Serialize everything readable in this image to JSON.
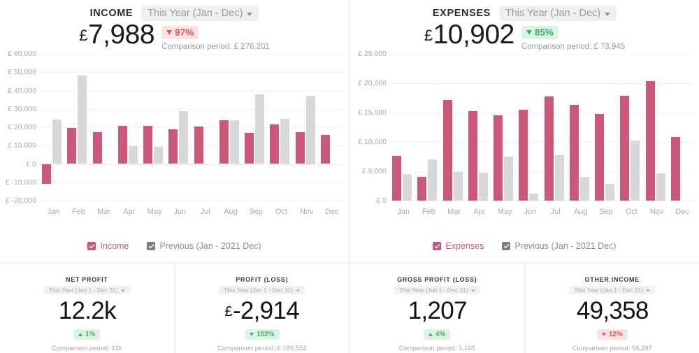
{
  "panels": [
    {
      "title": "INCOME",
      "period": "This Year (Jan - Dec)",
      "currency": "£",
      "value": "7,988",
      "delta": "97%",
      "delta_direction": "down",
      "delta_tone": "bad",
      "comparison": "Comparison period: £ 276,201",
      "legend": {
        "primary": "Income",
        "previous": "Previous (Jan - 2021 Dec)"
      },
      "accent": "#cb5878",
      "prev_color": "#d8d8d8",
      "chart_data": {
        "type": "bar",
        "title": "Income",
        "xlabel": "",
        "ylabel": "",
        "ylim": [
          -20000,
          60000
        ],
        "ytick_labels": [
          "£ 60,000",
          "£ 50,000",
          "£ 40,000",
          "£ 30,000",
          "£ 20,000",
          "£ 10,000",
          "£ 0",
          "£ -10,000",
          "£ -20,000"
        ],
        "yticks": [
          60000,
          50000,
          40000,
          30000,
          20000,
          10000,
          0,
          -10000,
          -20000
        ],
        "grid": true,
        "legend_position": "bottom",
        "categories": [
          "Jan",
          "Feb",
          "Mar",
          "Apr",
          "May",
          "Jun",
          "Jul",
          "Aug",
          "Sep",
          "Oct",
          "Nov",
          "Dec"
        ],
        "series": [
          {
            "name": "Income",
            "color": "#cb5878",
            "values": [
              -11000,
              19800,
              17200,
              20700,
              20900,
              18900,
              20400,
              23800,
              16800,
              21400,
              17200,
              15800
            ]
          },
          {
            "name": "Previous (Jan - 2021 Dec)",
            "color": "#d8d8d8",
            "values": [
              24200,
              48300,
              null,
              9900,
              9400,
              28600,
              null,
              23800,
              37900,
              24400,
              37000,
              null
            ]
          }
        ]
      }
    },
    {
      "title": "EXPENSES",
      "period": "This Year (Jan - Dec)",
      "currency": "£",
      "value": "10,902",
      "delta": "85%",
      "delta_direction": "down",
      "delta_tone": "good",
      "comparison": "Comparison period: £ 73,945",
      "legend": {
        "primary": "Expenses",
        "previous": "Previous (Jan - 2021 Dec)"
      },
      "accent": "#cb5878",
      "prev_color": "#d8d8d8",
      "chart_data": {
        "type": "bar",
        "title": "Expenses",
        "xlabel": "",
        "ylabel": "",
        "ylim": [
          0,
          25000
        ],
        "ytick_labels": [
          "£ 25,000",
          "£ 20,000",
          "£ 15,000",
          "£ 10,000",
          "£ 5,000",
          "£ 0"
        ],
        "yticks": [
          25000,
          20000,
          15000,
          10000,
          5000,
          0
        ],
        "grid": true,
        "legend_position": "bottom",
        "categories": [
          "Jan",
          "Feb",
          "Mar",
          "Apr",
          "May",
          "Jun",
          "Jul",
          "Aug",
          "Sep",
          "Oct",
          "Nov",
          "Dec"
        ],
        "series": [
          {
            "name": "Expenses",
            "color": "#cb5878",
            "values": [
              7600,
              4100,
              17100,
              15200,
              14500,
              15500,
              17700,
              16300,
              14800,
              17900,
              20300,
              10800
            ]
          },
          {
            "name": "Previous (Jan - 2021 Dec)",
            "color": "#d8d8d8",
            "values": [
              4500,
              7000,
              4900,
              4800,
              7500,
              1200,
              7700,
              4100,
              2800,
              10200,
              4700,
              null
            ]
          }
        ]
      }
    }
  ],
  "kpis": [
    {
      "title": "NET PROFIT",
      "period": "This Year (Jan 1 - Dec 31)",
      "currency": "",
      "value": "12.2k",
      "delta": "1%",
      "delta_direction": "up",
      "delta_tone": "good",
      "comparison": "Comparison period: 12k"
    },
    {
      "title": "PROFIT (LOSS)",
      "period": "This Year (Jan 1 - Dec 31)",
      "currency": "£",
      "value": "-2,914",
      "delta": "102%",
      "delta_direction": "down",
      "delta_tone": "good",
      "comparison": "Comparison period: £ 189,552"
    },
    {
      "title": "GROSS PROFIT (LOSS)",
      "period": "This Year (Jan 1 - Dec 31)",
      "currency": "",
      "value": "1,207",
      "delta": "4%",
      "delta_direction": "up",
      "delta_tone": "good",
      "comparison": "Comparison period: 1,155"
    },
    {
      "title": "OTHER INCOME",
      "period": "This Year (Jan 1 - Dec 31)",
      "currency": "",
      "value": "49,358",
      "delta": "12%",
      "delta_direction": "down",
      "delta_tone": "bad",
      "comparison": "Comparison period: 56,397"
    }
  ],
  "colors": {
    "accent_pink": "#cb5878",
    "previous_gray": "#d8d8d8",
    "positive_green": "#3cb371",
    "negative_red": "#e4574f",
    "positive_bg": "#def3e4",
    "negative_bg": "#fbe3e3"
  }
}
